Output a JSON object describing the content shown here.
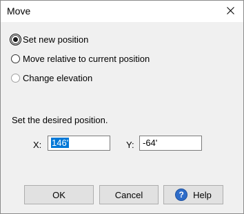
{
  "window": {
    "title": "Move"
  },
  "options": [
    {
      "label": "Set new position",
      "checked": true
    },
    {
      "label": "Move relative to current position",
      "checked": false
    },
    {
      "label": "Change elevation",
      "checked": false,
      "disabled": true
    }
  ],
  "position": {
    "hint": "Set the desired position.",
    "x_label": "X:",
    "x_value": "146'",
    "y_label": "Y:",
    "y_value": "-64'"
  },
  "buttons": {
    "ok": "OK",
    "cancel": "Cancel",
    "help": "Help",
    "help_glyph": "?"
  },
  "icons": {
    "close": "close-icon",
    "help": "help-icon"
  },
  "colors": {
    "selection": "#0078d7",
    "help_icon": "#2e6cc8"
  }
}
